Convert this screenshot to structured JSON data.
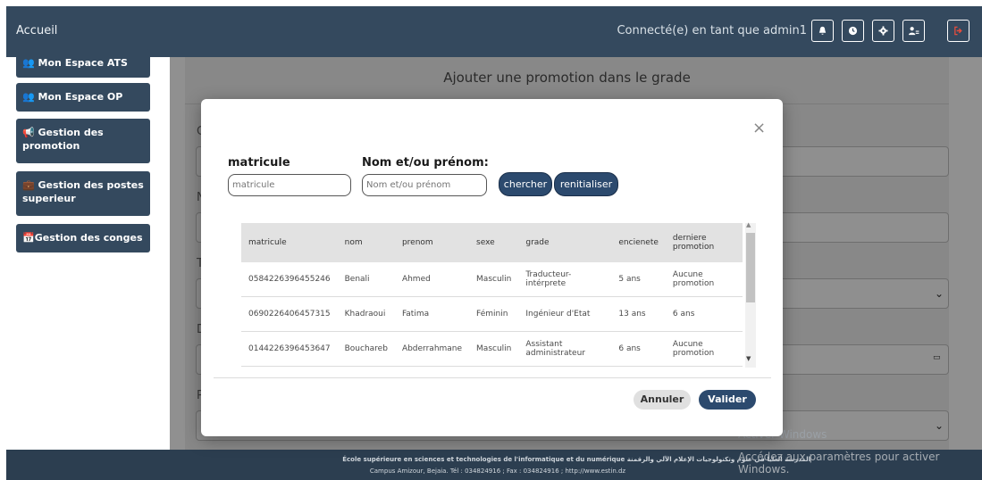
{
  "navbar": {
    "brand": "Accueil",
    "user_text": "Connecté(e) en tant que admin1",
    "icons": [
      "bell-icon",
      "clock-icon",
      "gear-icon",
      "users-icon",
      "logout-icon"
    ]
  },
  "sidebar": {
    "items": [
      {
        "label": "Mon Espace ATS"
      },
      {
        "label": "Mon Espace OP"
      },
      {
        "label": "Gestion des promotion"
      },
      {
        "label": "Gestion des postes superieur"
      },
      {
        "label": "Gestion des conges"
      }
    ]
  },
  "page": {
    "title": "Ajouter une promotion dans le grade",
    "bg_letters": [
      "C",
      "N",
      "T",
      "D",
      "P"
    ]
  },
  "modal": {
    "matricule_label": "matricule",
    "matricule_placeholder": "matricule",
    "name_label": "Nom et/ou prénom:",
    "name_placeholder": "Nom et/ou prénom",
    "search_button": "chercher",
    "reset_button": "renitialiser",
    "cancel_button": "Annuler",
    "validate_button": "Valider",
    "close_symbol": "×",
    "table": {
      "headers": [
        "matricule",
        "nom",
        "prenom",
        "sexe",
        "grade",
        "encienete",
        "derniere promotion"
      ],
      "rows": [
        [
          "0584226396455246",
          "Benali",
          "Ahmed",
          "Masculin",
          "Traducteur-intérprete",
          "5 ans",
          "Aucune promotion"
        ],
        [
          "0690226406457315",
          "Khadraoui",
          "Fatima",
          "Féminin",
          "Ingénieur d'Etat",
          "13 ans",
          "6 ans"
        ],
        [
          "0144226396453647",
          "Bouchareb",
          "Abderrahmane",
          "Masculin",
          "Assistant administrateur",
          "6 ans",
          "Aucune promotion"
        ]
      ]
    }
  },
  "footer": {
    "line1": "École supérieure en sciences et technologies de l'informatique et du numérique المدرسة العليا في علوم وتكنولوجيات الإعلام الآلي والرقمنة",
    "line2": "Campus Amizour, Bejaia. Tél : 034824916 ; Fax : 034824916 ; http://www.estin.dz"
  },
  "watermark": {
    "line1": "Activer Windows",
    "line2": "Accédez aux paramètres pour activer Windows."
  }
}
